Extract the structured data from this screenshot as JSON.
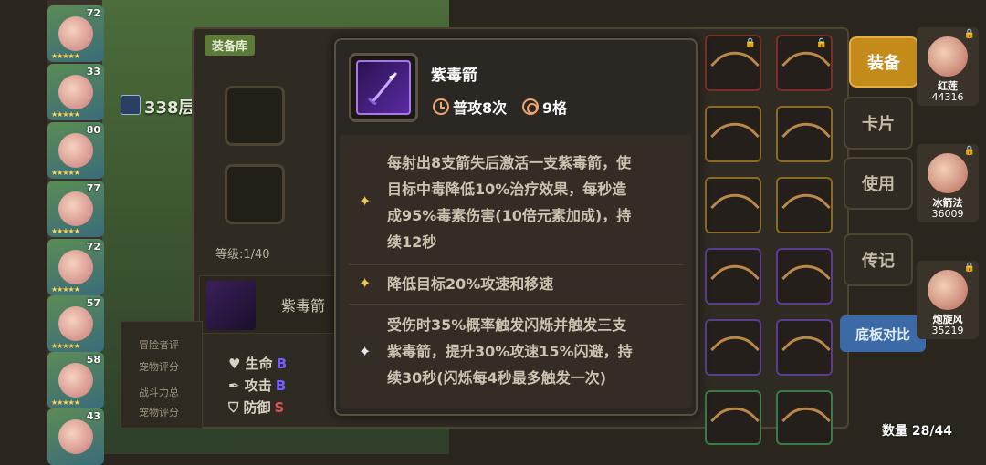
{
  "heroes_left": [
    {
      "level": "72"
    },
    {
      "level": "33"
    },
    {
      "level": "80"
    },
    {
      "level": "77"
    },
    {
      "level": "72"
    },
    {
      "level": "57"
    },
    {
      "level": "58"
    },
    {
      "level": "43"
    }
  ],
  "floor": {
    "text": "338层"
  },
  "equip_library": {
    "tab_label": "装备库",
    "level_label": "等级:1/40",
    "weapon_name": "紫毒箭"
  },
  "stats": [
    {
      "label": "生命",
      "grade": "B"
    },
    {
      "label": "攻击",
      "grade": "B"
    },
    {
      "label": "防御",
      "grade": "S"
    }
  ],
  "dim_info": [
    "冒险者评",
    "宠物评分",
    "战斗力总",
    "宠物评分"
  ],
  "side_buttons": {
    "equip": "装备",
    "card": "卡片",
    "use": "使用",
    "biography": "传记",
    "compare": "底板对比"
  },
  "right_heroes": [
    {
      "name": "红莲",
      "power": "44316"
    },
    {
      "name": "冰箭法",
      "power": "36009"
    },
    {
      "name": "炮旋风",
      "power": "35219"
    }
  ],
  "count": {
    "text": "数量 28/44"
  },
  "tooltip": {
    "name": "紫毒箭",
    "attack_count": "普攻8次",
    "range": "9格",
    "effects": [
      {
        "icon": "gold-star-icon",
        "lines": [
          "每射出8支箭失后激活一支紫毒箭，使",
          "目标中毒降低10%治疗效果，每秒造",
          "成95%毒素伤害(10倍元素加成)，持",
          "续12秒"
        ]
      },
      {
        "icon": "gold-star-icon",
        "lines": [
          "降低目标20%攻速和移速"
        ]
      },
      {
        "icon": "silver-star-icon",
        "lines": [
          "受伤时35%概率触发闪烁并触发三支",
          "紫毒箭，提升30%攻速15%闪避，持",
          "续30秒(闪烁每4秒最多触发一次)"
        ]
      }
    ]
  },
  "colors": {
    "gold": "#f2c94c",
    "equip_button": "#c48a1a",
    "compare_button": "#3b6aa6",
    "grade_B": "#7b5cff",
    "grade_S": "#e05050"
  }
}
